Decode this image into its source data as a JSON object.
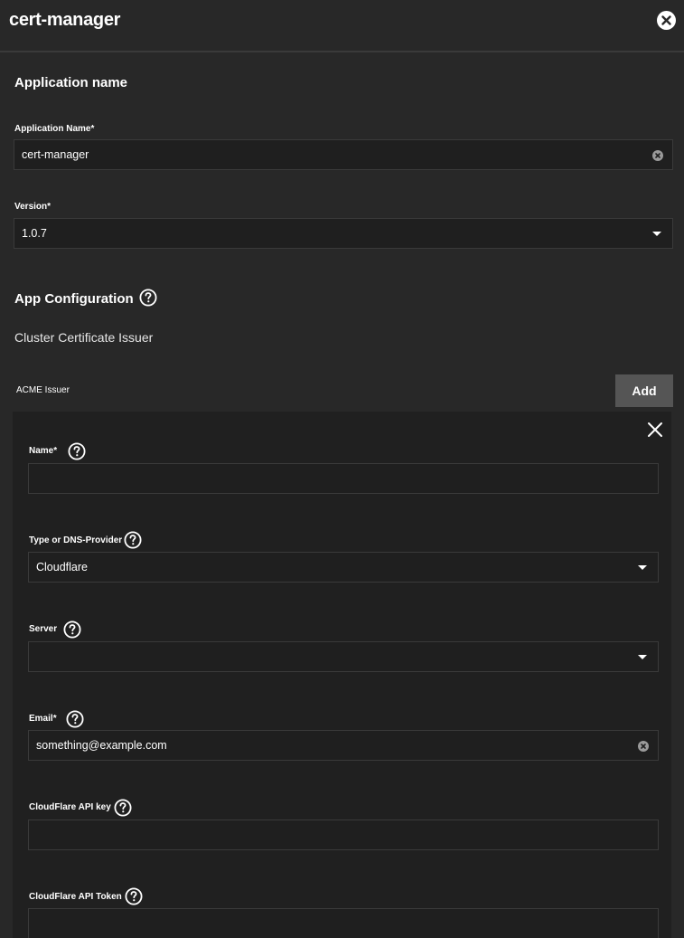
{
  "header": {
    "title": "cert-manager"
  },
  "app_name_section": {
    "title": "Application name",
    "app_name_label": "Application Name",
    "app_name_value": "cert-manager",
    "version_label": "Version",
    "version_value": "1.0.7",
    "required_mark": "*"
  },
  "app_config": {
    "title": "App Configuration",
    "subtitle": "Cluster Certificate Issuer",
    "acme_label": "ACME Issuer",
    "add_label": "Add"
  },
  "issuer": {
    "name_label": "Name",
    "name_value": "",
    "type_label": "Type or DNS-Provider",
    "type_value": "Cloudflare",
    "server_label": "Server",
    "server_value": "",
    "email_label": "Email",
    "email_value": "something@example.com",
    "api_key_label": "CloudFlare API key",
    "api_key_value": "",
    "api_token_label": "CloudFlare API Token",
    "api_token_value": ""
  }
}
